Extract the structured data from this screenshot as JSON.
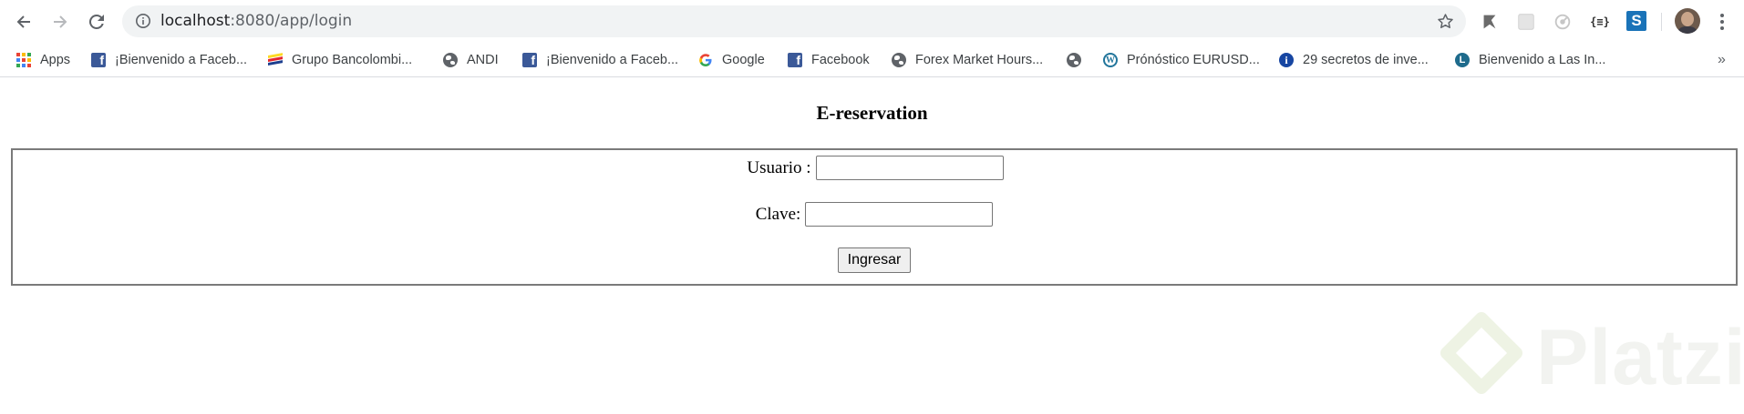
{
  "browser": {
    "url_host": "localhost",
    "url_path": ":8080/app/login",
    "icons": {
      "back": "back-arrow-icon",
      "forward": "forward-arrow-icon",
      "reload": "reload-icon",
      "info": "info-icon",
      "bookmark_star": "star-icon",
      "menu": "kebab-menu-icon"
    },
    "extensions": {
      "brackets_label": "{≡}",
      "s_label": "S"
    }
  },
  "bookmarks": [
    {
      "label": "Apps",
      "favicon": "apps-grid-icon"
    },
    {
      "label": "¡Bienvenido a Faceb...",
      "favicon": "facebook-icon"
    },
    {
      "label": "Grupo Bancolombi...",
      "favicon": "bancolombia-icon"
    },
    {
      "label": "ANDI",
      "favicon": "globe-icon"
    },
    {
      "label": "¡Bienvenido a Faceb...",
      "favicon": "facebook-icon"
    },
    {
      "label": "Google",
      "favicon": "google-icon"
    },
    {
      "label": "Facebook",
      "favicon": "facebook-icon"
    },
    {
      "label": "Forex Market Hours...",
      "favicon": "globe-icon"
    },
    {
      "label": "",
      "favicon": "globe-icon"
    },
    {
      "label": "Prónóstico EURUSD...",
      "favicon": "wordpress-icon"
    },
    {
      "label": "29 secretos de inve...",
      "favicon": "info-icon"
    },
    {
      "label": "Bienvenido a Las In...",
      "favicon": "l-letter-icon"
    }
  ],
  "bookmarks_overflow": "»",
  "page": {
    "title": "E-reservation",
    "form": {
      "user_label": "Usuario :",
      "user_value": "",
      "password_label": "Clave:",
      "password_value": "",
      "submit_label": "Ingresar"
    }
  },
  "watermark": {
    "text": "Platzi"
  },
  "colors": {
    "omnibox_bg": "#f1f3f4",
    "form_border": "#7a7a7a",
    "facebook_blue": "#3b5998",
    "watermark": "#f2f3f0"
  }
}
